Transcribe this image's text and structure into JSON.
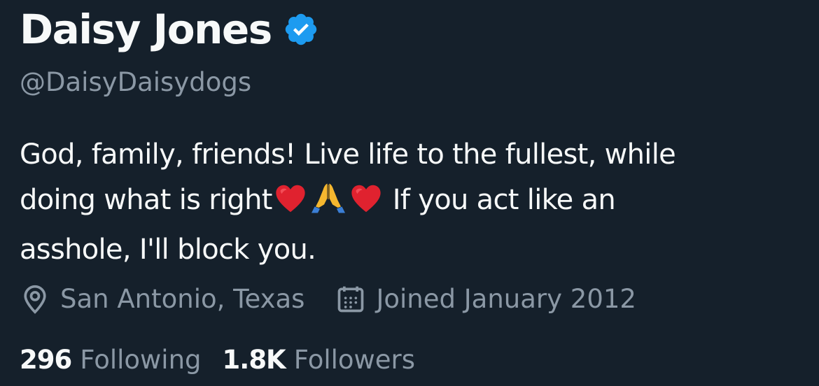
{
  "profile": {
    "display_name": "Daisy Jones",
    "verified_icon": "verified-badge-icon",
    "handle": "@DaisyDaisydogs",
    "bio": {
      "line1": "God, family, friends! Live life to the fullest, while",
      "line2_start": "doing what is right",
      "line2_end": " If you act like an",
      "line3": "asshole, I'll block you.",
      "emojis": [
        "red-heart",
        "folded-hands",
        "red-heart"
      ]
    },
    "location": "San Antonio, Texas",
    "joined": "Joined January 2012",
    "following_count": "296",
    "following_label": "Following",
    "followers_count": "1.8K",
    "followers_label": "Followers"
  },
  "colors": {
    "background": "#15202b",
    "primary_text": "#f7f9f9",
    "secondary_text": "#8b98a5",
    "verified_blue": "#1d9bf0"
  }
}
